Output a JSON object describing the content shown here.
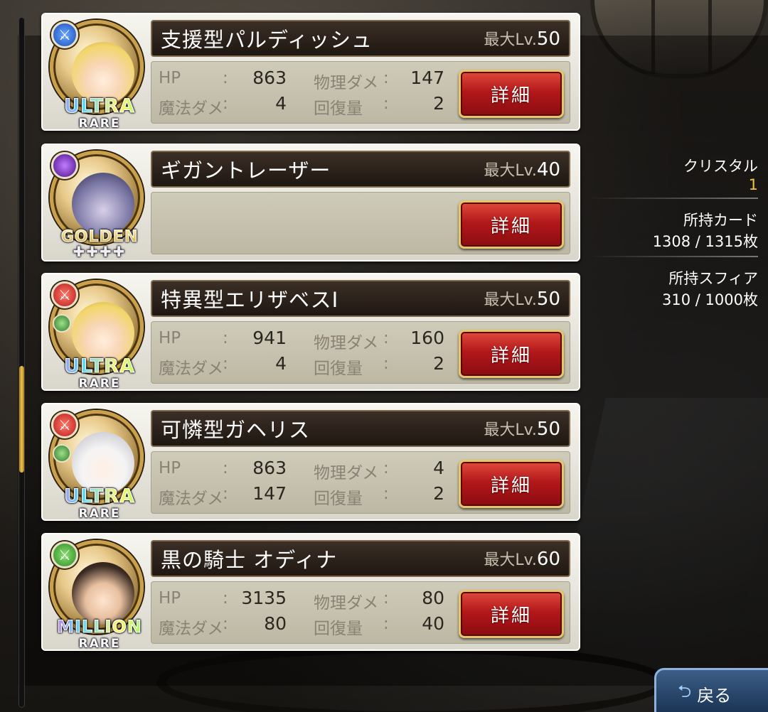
{
  "cards": [
    {
      "name": "支援型パルディッシュ",
      "max_lv_prefix": "最大Lv.",
      "max_lv": "50",
      "attr_color": "blue",
      "rarity": "ULTRA",
      "rarity_sub": "RARE",
      "has_stats": true,
      "stats": {
        "hp": "863",
        "phys": "147",
        "magic": "4",
        "heal": "2"
      },
      "detail_label": "詳細"
    },
    {
      "name": "ギガントレーザー",
      "max_lv_prefix": "最大Lv.",
      "max_lv": "40",
      "attr_color": "purple",
      "rarity": "GOLDEN",
      "rarity_sub": "✚✚✚✚",
      "has_stats": false,
      "stats": null,
      "detail_label": "詳細"
    },
    {
      "name": "特異型エリザベスⅠ",
      "max_lv_prefix": "最大Lv.",
      "max_lv": "50",
      "attr_color": "red",
      "rarity": "ULTRA",
      "rarity_sub": "RARE",
      "has_stats": true,
      "stats": {
        "hp": "941",
        "phys": "160",
        "magic": "4",
        "heal": "2"
      },
      "detail_label": "詳細"
    },
    {
      "name": "可憐型ガヘリス",
      "max_lv_prefix": "最大Lv.",
      "max_lv": "50",
      "attr_color": "red",
      "rarity": "ULTRA",
      "rarity_sub": "RARE",
      "has_stats": true,
      "stats": {
        "hp": "863",
        "phys": "4",
        "magic": "147",
        "heal": "2"
      },
      "detail_label": "詳細"
    },
    {
      "name": "黒の騎士 オディナ",
      "max_lv_prefix": "最大Lv.",
      "max_lv": "60",
      "attr_color": "green",
      "rarity": "MILLION",
      "rarity_sub": "RARE",
      "has_stats": true,
      "stats": {
        "hp": "3135",
        "phys": "80",
        "magic": "80",
        "heal": "40"
      },
      "detail_label": "詳細"
    }
  ],
  "stat_labels": {
    "hp": "HP",
    "colon": ":",
    "phys": "物理ダメ",
    "magic": "魔法ダメ",
    "heal": "回復量"
  },
  "side": {
    "crystal_label": "クリスタル",
    "crystal_value": "1",
    "cards_label": "所持カード",
    "cards_value": "1308 / 1315枚",
    "sphere_label": "所持スフィア",
    "sphere_value": "310 / 1000枚"
  },
  "back_label": "戻る",
  "colors": {
    "accent_gold": "#f6c23a",
    "detail_red": "#b3181a",
    "back_blue": "#16304f"
  }
}
